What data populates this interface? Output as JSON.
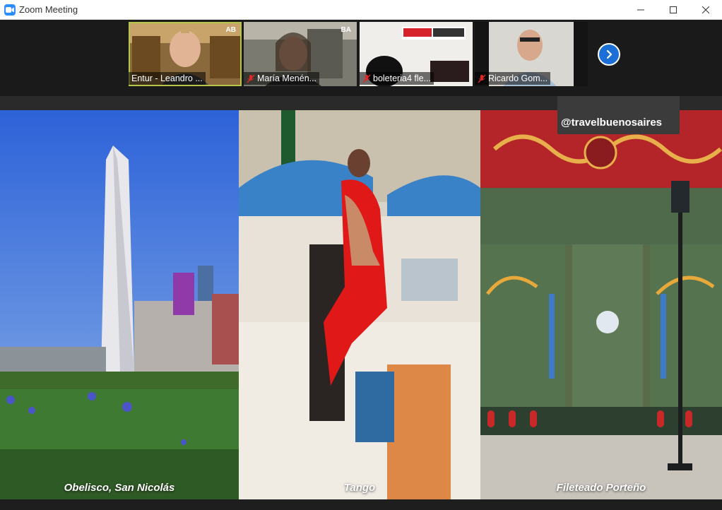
{
  "window": {
    "title": "Zoom Meeting"
  },
  "participants": [
    {
      "name": "Entur - Leandro ...",
      "muted": false,
      "badge": "AB"
    },
    {
      "name": "María Menén...",
      "muted": true,
      "badge": "BA"
    },
    {
      "name": "boleteria4 fle...",
      "muted": true,
      "badge": ""
    },
    {
      "name": "Ricardo Gom...",
      "muted": true,
      "badge": ""
    }
  ],
  "share": {
    "handle": "@travelbuenosaires",
    "panels": [
      {
        "caption": "Obelisco, San Nicolás"
      },
      {
        "caption": "Tango"
      },
      {
        "caption": "Fileteado Porteño"
      }
    ]
  },
  "colors": {
    "zoom_blue": "#2d8cff",
    "active_speaker": "#b6c64a",
    "muted_red": "#e02828"
  }
}
